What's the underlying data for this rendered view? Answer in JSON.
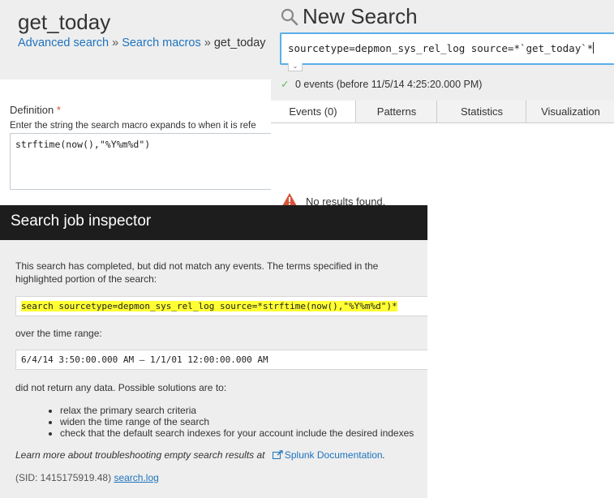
{
  "macro": {
    "title": "get_today",
    "breadcrumb": {
      "advanced_search": "Advanced search",
      "sep1": "»",
      "search_macros": "Search macros",
      "sep2": "»",
      "current": "get_today"
    },
    "definition_label": "Definition",
    "required_mark": "*",
    "definition_help": "Enter the string the search macro expands to when it is refe",
    "definition_value": "strftime(now(),\"%Y%m%d\")"
  },
  "search": {
    "title": "New Search",
    "query": "sourcetype=depmon_sys_rel_log source=*`get_today`*",
    "status_check": "✓",
    "status": "0 events (before 11/5/14 4:25:20.000 PM)",
    "tabs": [
      {
        "label": "Events (0)"
      },
      {
        "label": "Patterns"
      },
      {
        "label": "Statistics"
      },
      {
        "label": "Visualization"
      }
    ],
    "no_results": "No results found."
  },
  "inspector": {
    "title": "Search job inspector",
    "intro": "This search has completed, but did not match any events. The terms specified in the highlighted portion of the search:",
    "highlighted_search": "search sourcetype=depmon_sys_rel_log source=*strftime(now(),\"%Y%m%d\")*",
    "over_time_label": "over the time range:",
    "time_range": "6/4/14 3:50:00.000 AM – 1/1/01 12:00:00.000 AM",
    "no_data_text": "did not return any data. Possible solutions are to:",
    "solutions": [
      "relax the primary search criteria",
      "widen the time range of the search",
      "check that the default search indexes for your account include the desired indexes"
    ],
    "learn_more": "Learn more about troubleshooting empty search results at",
    "docs_link": "Splunk Documentation",
    "docs_period": ".",
    "sid_prefix": "(SID: 1415175919.48)",
    "search_log_link": "search.log"
  },
  "colors": {
    "link": "#1e73be",
    "highlight": "#ffff33",
    "inspector_titlebar": "#1d1d1d",
    "search_focus": "#5aaee8"
  }
}
